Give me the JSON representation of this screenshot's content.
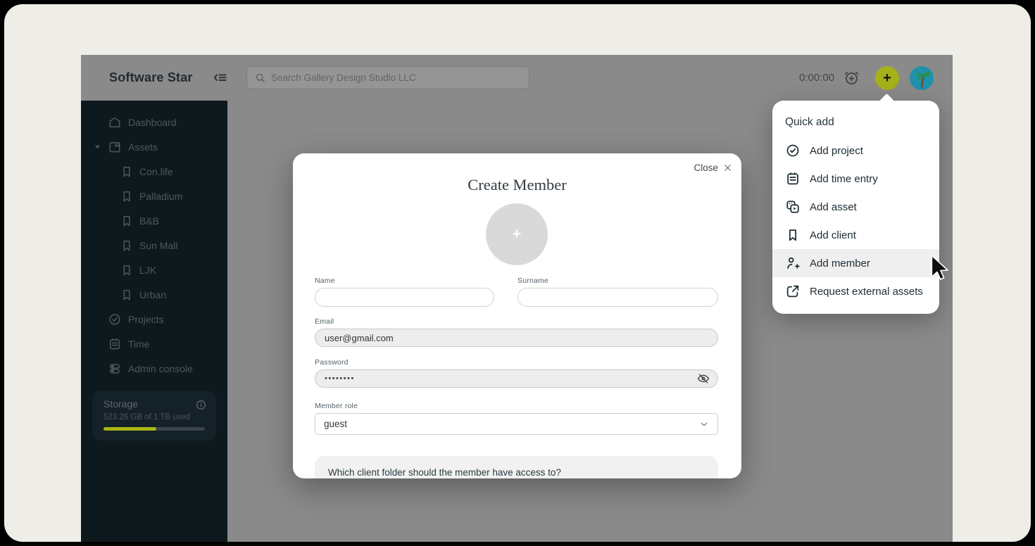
{
  "topbar": {
    "logo": "Software Star",
    "search_placeholder": "Search Gallery Design Studio LLC",
    "timer": "0:00:00",
    "plus_label": "+"
  },
  "sidebar": {
    "dashboard": "Dashboard",
    "assets": "Assets",
    "asset_folders": [
      "Con.life",
      "Palladium",
      "B&B",
      "Sun Mall",
      "LJK",
      "Urban"
    ],
    "projects": "Projects",
    "time": "Time",
    "admin_console": "Admin console",
    "storage": {
      "title": "Storage",
      "usage": "523.26 GB of 1 TB used",
      "percent_used": 52
    }
  },
  "modal": {
    "close_label": "Close",
    "title": "Create Member",
    "avatar_plus": "+",
    "fields": {
      "name_label": "Name",
      "surname_label": "Surname",
      "email_label": "Email",
      "email_value": "user@gmail.com",
      "password_label": "Password",
      "password_value": "••••••••",
      "member_role_label": "Member role",
      "member_role_value": "guest"
    },
    "question": "Which client folder should the member have access to?"
  },
  "quick_add": {
    "title": "Quick add",
    "items": [
      {
        "label": "Add project",
        "icon": "check-circle-icon"
      },
      {
        "label": "Add time entry",
        "icon": "calendar-icon"
      },
      {
        "label": "Add asset",
        "icon": "media-copies-icon"
      },
      {
        "label": "Add client",
        "icon": "bookmark-icon"
      },
      {
        "label": "Add member",
        "icon": "person-plus-icon",
        "highlighted": true
      },
      {
        "label": "Request external assets",
        "icon": "external-link-icon"
      }
    ]
  },
  "colors": {
    "accent_green": "#a6b01b",
    "avatar_teal": "#1f91ab",
    "sidebar_bg": "#0e191e",
    "frame_cream": "#eeede7",
    "app_dim_grey": "#8a8a8a",
    "menu_text": "#1c2b33",
    "progress_fill": "#a9b413"
  }
}
